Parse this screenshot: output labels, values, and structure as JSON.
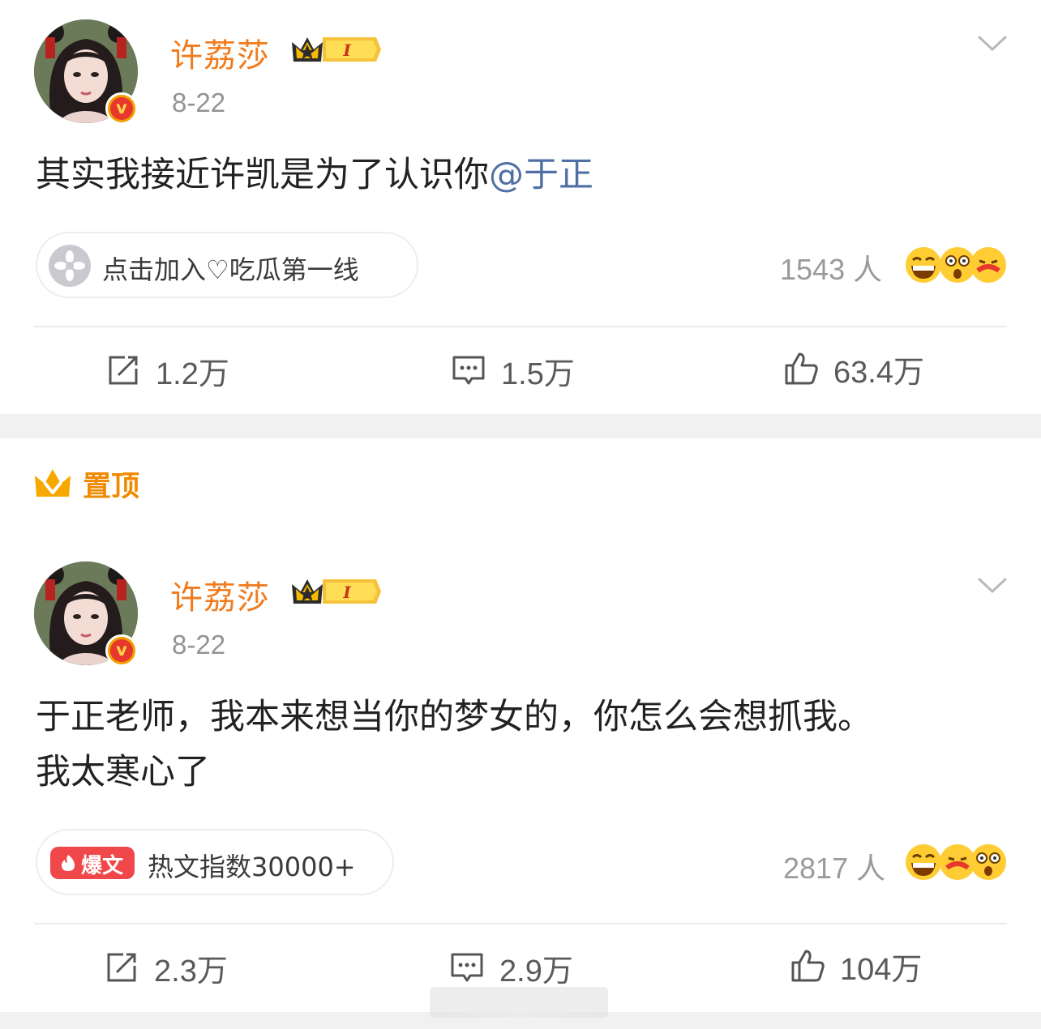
{
  "posts": [
    {
      "username": "许荔莎",
      "vip_level": "I",
      "date": "8-22",
      "text": "其实我接近许凯是为了认识你",
      "mention": "@于正",
      "tag_label": "点击加入♡吃瓜第一线",
      "reactor_count": "1543 人",
      "repost_count": "1.2万",
      "comment_count": "1.5万",
      "like_count": "63.4万"
    },
    {
      "pinned_label": "置顶",
      "username": "许荔莎",
      "vip_level": "I",
      "date": "8-22",
      "text_line1": "于正老师，我本来想当你的梦女的，你怎么会想抓我。",
      "text_line2": "我太寒心了",
      "hot_badge": "爆文",
      "tag_label": "热文指数30000+",
      "reactor_count": "2817 人",
      "repost_count": "2.3万",
      "comment_count": "2.9万",
      "like_count": "104万"
    }
  ],
  "colors": {
    "username": "#f17b1c",
    "mention": "#4f6fa5",
    "pin": "#f08a00",
    "hot_badge": "#f0474b"
  }
}
